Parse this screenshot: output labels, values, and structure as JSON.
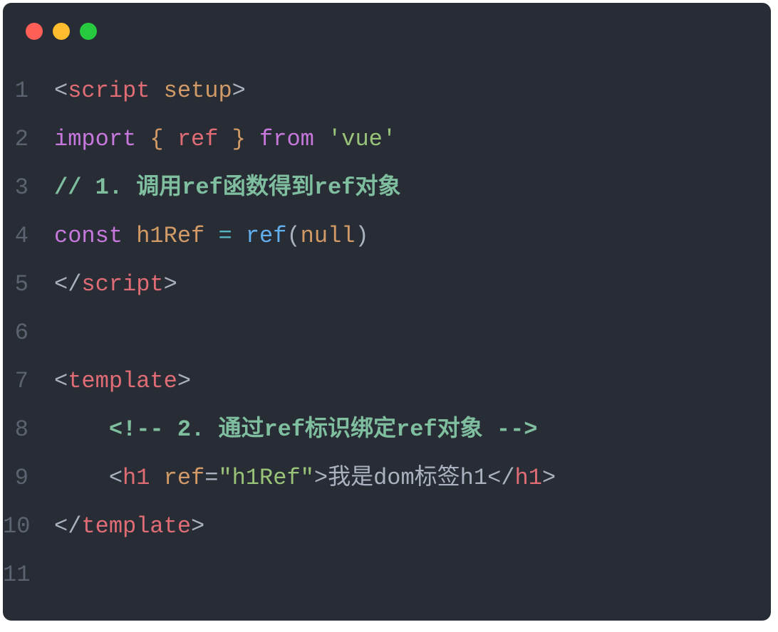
{
  "lineNumbers": [
    "1",
    "2",
    "3",
    "4",
    "5",
    "6",
    "7",
    "8",
    "9",
    "10",
    "11"
  ],
  "tokens": {
    "l1": {
      "t1": "<",
      "t2": "script",
      "t3": " ",
      "t4": "setup",
      "t5": ">"
    },
    "l2": {
      "t1": "import",
      "t2": " { ",
      "t3": "ref",
      "t4": " } ",
      "t5": "from",
      "t6": " ",
      "t7": "'vue'"
    },
    "l3": {
      "t1": "// 1. 调用ref函数得到ref对象"
    },
    "l4": {
      "t1": "const",
      "t2": " ",
      "t3": "h1Ref",
      "t4": " ",
      "t5": "=",
      "t6": " ",
      "t7": "ref",
      "t8": "(",
      "t9": "null",
      "t10": ")"
    },
    "l5": {
      "t1": "</",
      "t2": "script",
      "t3": ">"
    },
    "l7": {
      "t1": "<",
      "t2": "template",
      "t3": ">"
    },
    "l8": {
      "t1": "    ",
      "t2": "<!-- 2. 通过ref标识绑定ref对象 -->"
    },
    "l9": {
      "t1": "    ",
      "t2": "<",
      "t3": "h1",
      "t4": " ",
      "t5": "ref",
      "t6": "=",
      "t7": "\"h1Ref\"",
      "t8": ">",
      "t9": "我是dom标签h1",
      "t10": "</",
      "t11": "h1",
      "t12": ">"
    },
    "l10": {
      "t1": "</",
      "t2": "template",
      "t3": ">"
    }
  }
}
